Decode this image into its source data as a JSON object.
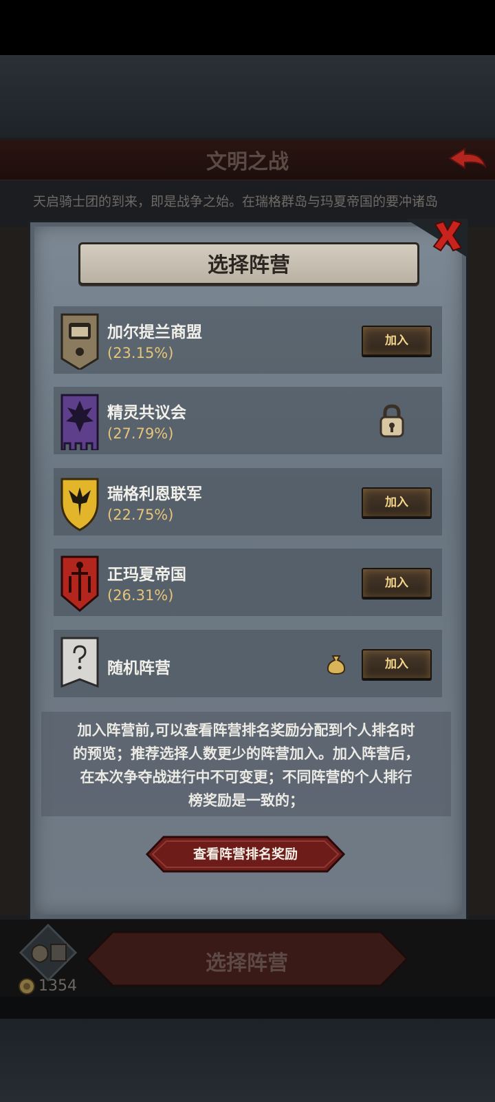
{
  "screen": {
    "title": "文明之战",
    "intro": "天启骑士团的到来，即是战争之始。在瑞格群岛与玛夏帝国的要冲诸岛"
  },
  "modal": {
    "title": "选择阵营",
    "factions": [
      {
        "name": "加尔提兰商盟",
        "percent": "(23.15%)",
        "action": "加入",
        "state": "open",
        "icon": "treasure-chest-banner-icon",
        "color": "#8a7a5e"
      },
      {
        "name": "精灵共议会",
        "percent": "(27.79%)",
        "action": "",
        "state": "locked",
        "icon": "purple-leaf-banner-icon",
        "color": "#5e3f8c"
      },
      {
        "name": "瑞格利恩联军",
        "percent": "(22.75%)",
        "action": "加入",
        "state": "open",
        "icon": "golden-shield-crest-icon",
        "color": "#e2b52a"
      },
      {
        "name": "正玛夏帝国",
        "percent": "(26.31%)",
        "action": "加入",
        "state": "open",
        "icon": "red-sword-banner-icon",
        "color": "#b3261e"
      },
      {
        "name": "随机阵营",
        "percent": "",
        "action": "加入",
        "state": "open",
        "icon": "question-mark-banner-icon",
        "color": "#d8d6d2",
        "bonus_icon": "coin-bag-icon"
      }
    ],
    "note_lines": [
      "加入阵营前,可以查看阵营排名奖励分配到个人排名时",
      "的预览；推荐选择人数更少的阵营加入。加入阵营后，",
      "在本次争夺战进行中不可变更；不同阵营的个人排行",
      "榜奖励是一致的；"
    ],
    "reward_button": "查看阵营排名奖励"
  },
  "footer": {
    "coins": "1354",
    "select_label": "选择阵营"
  }
}
